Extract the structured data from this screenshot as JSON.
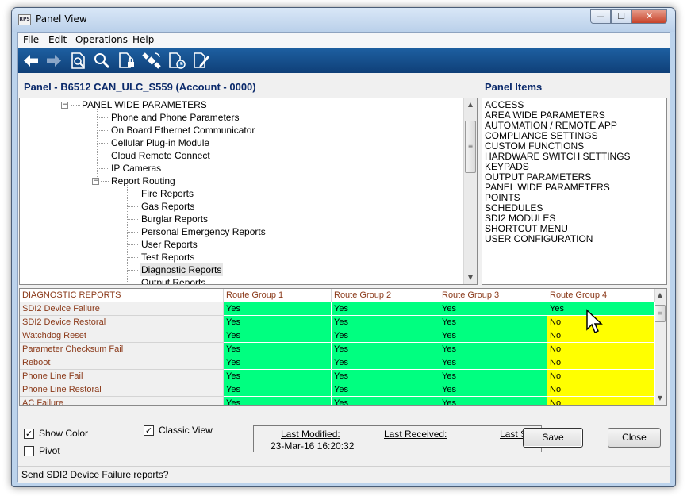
{
  "window": {
    "title": "Panel View",
    "icon_text": "RPS",
    "controls": {
      "minimize": "—",
      "maximize": "☐",
      "close": "✕"
    }
  },
  "menu": [
    "File",
    "Edit",
    "Operations",
    "Help"
  ],
  "toolbar": {
    "buttons": [
      {
        "icon": "back-arrow-icon"
      },
      {
        "icon": "forward-arrow-icon"
      },
      {
        "icon": "document-search-icon"
      },
      {
        "icon": "magnifier-icon"
      },
      {
        "icon": "document-lock-icon"
      },
      {
        "icon": "satellite-connect-icon"
      },
      {
        "icon": "document-clock-icon"
      },
      {
        "icon": "document-edit-icon"
      }
    ]
  },
  "header": {
    "panel_title": "Panel - B6512 CAN_ULC_S559 (Account - 0000)",
    "items_title": "Panel Items"
  },
  "tree": [
    {
      "label": "PANEL WIDE PARAMETERS",
      "level": 0,
      "expander": "−"
    },
    {
      "label": "Phone and Phone Parameters",
      "level": 1
    },
    {
      "label": "On Board Ethernet Communicator",
      "level": 1
    },
    {
      "label": "Cellular Plug-in Module",
      "level": 1
    },
    {
      "label": "Cloud Remote Connect",
      "level": 1
    },
    {
      "label": "IP Cameras",
      "level": 1
    },
    {
      "label": "Report Routing",
      "level": 1,
      "expander": "−"
    },
    {
      "label": "Fire Reports",
      "level": 2
    },
    {
      "label": "Gas Reports",
      "level": 2
    },
    {
      "label": "Burglar Reports",
      "level": 2
    },
    {
      "label": "Personal Emergency Reports",
      "level": 2
    },
    {
      "label": "User Reports",
      "level": 2
    },
    {
      "label": "Test Reports",
      "level": 2
    },
    {
      "label": "Diagnostic Reports",
      "level": 2,
      "selected": true
    },
    {
      "label": "Output Reports",
      "level": 2
    }
  ],
  "panel_items": [
    "ACCESS",
    "AREA WIDE PARAMETERS",
    "AUTOMATION / REMOTE APP",
    "COMPLIANCE SETTINGS",
    "CUSTOM FUNCTIONS",
    "HARDWARE SWITCH SETTINGS",
    "KEYPADS",
    "OUTPUT PARAMETERS",
    "PANEL WIDE PARAMETERS",
    "POINTS",
    "SCHEDULES",
    "SDI2 MODULES",
    "SHORTCUT MENU",
    "USER CONFIGURATION"
  ],
  "grid": {
    "headers": [
      "DIAGNOSTIC REPORTS",
      "Route Group 1",
      "Route Group 2",
      "Route Group 3",
      "Route Group 4"
    ],
    "rows": [
      {
        "label": "SDI2 Device Failure",
        "values": [
          "Yes",
          "Yes",
          "Yes",
          "Yes"
        ]
      },
      {
        "label": "SDI2 Device Restoral",
        "values": [
          "Yes",
          "Yes",
          "Yes",
          "No"
        ]
      },
      {
        "label": "Watchdog Reset",
        "values": [
          "Yes",
          "Yes",
          "Yes",
          "No"
        ]
      },
      {
        "label": "Parameter Checksum Fail",
        "values": [
          "Yes",
          "Yes",
          "Yes",
          "No"
        ]
      },
      {
        "label": "Reboot",
        "values": [
          "Yes",
          "Yes",
          "Yes",
          "No"
        ]
      },
      {
        "label": "Phone Line Fail",
        "values": [
          "Yes",
          "Yes",
          "Yes",
          "No"
        ]
      },
      {
        "label": "Phone Line Restoral",
        "values": [
          "Yes",
          "Yes",
          "Yes",
          "No"
        ]
      },
      {
        "label": "AC Failure",
        "values": [
          "Yes",
          "Yes",
          "Yes",
          "No"
        ]
      }
    ],
    "colors": {
      "yes": "#00ff80",
      "no": "#ffff00"
    }
  },
  "options": {
    "show_color": {
      "label": "Show Color",
      "checked": true
    },
    "pivot": {
      "label": "Pivot",
      "checked": false
    },
    "classic_view": {
      "label": "Classic View",
      "checked": true
    }
  },
  "info": {
    "last_modified_label": "Last Modified:",
    "last_received_label": "Last Received:",
    "last_s_label": "Last S",
    "last_modified_value": "23-Mar-16 16:20:32"
  },
  "buttons": {
    "save": "Save",
    "close": "Close"
  },
  "status": "Send SDI2 Device Failure reports?"
}
